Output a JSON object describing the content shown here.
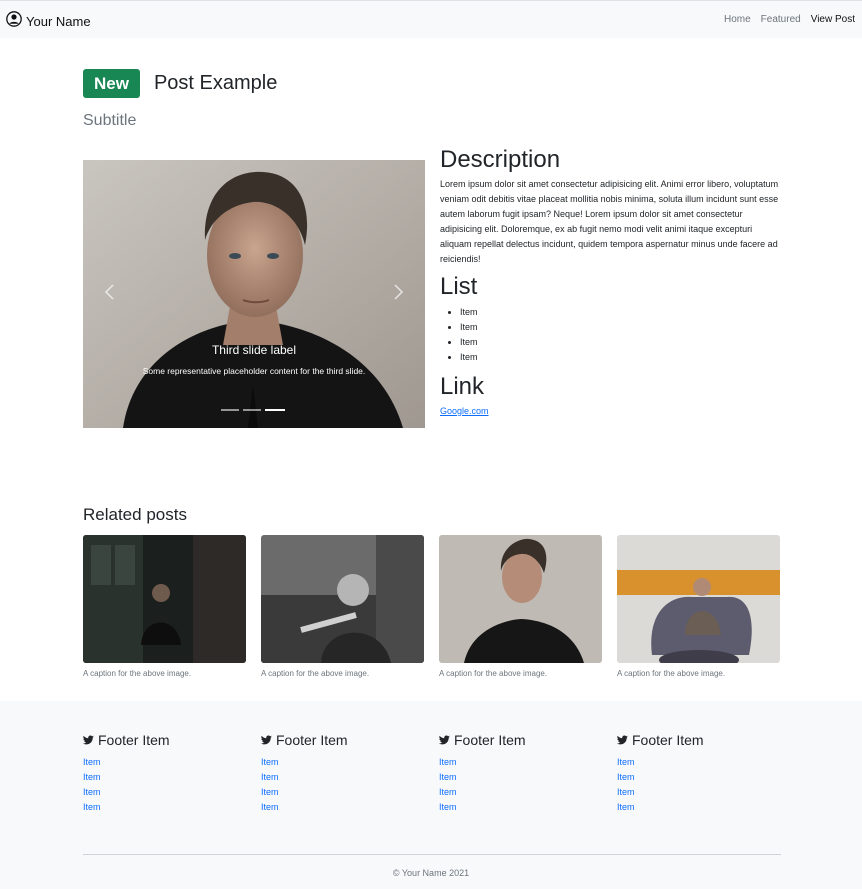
{
  "navbar": {
    "brand": "Your Name",
    "links": [
      {
        "label": "Home"
      },
      {
        "label": "Featured"
      },
      {
        "label": "View Post"
      }
    ]
  },
  "post": {
    "badge": "New",
    "title": "Post Example",
    "subtitle": "Subtitle"
  },
  "carousel": {
    "caption_title": "Third slide label",
    "caption_text": "Some representative placeholder content for the third slide.",
    "slide_count": 3,
    "active_slide": 3
  },
  "description": {
    "heading": "Description",
    "body": "Lorem ipsum dolor sit amet consectetur adipisicing elit. Animi error libero, voluptatum veniam odit debitis vitae placeat mollitia nobis minima, soluta illum incidunt sunt esse autem laborum fugit ipsam? Neque! Lorem ipsum dolor sit amet consectetur adipisicing elit. Doloremque, ex ab fugit nemo modi velit animi itaque excepturi aliquam repellat delectus incidunt, quidem tempora aspernatur minus unde facere ad reiciendis!",
    "list_heading": "List",
    "list_items": [
      "Item",
      "Item",
      "Item",
      "Item"
    ],
    "link_heading": "Link",
    "link_text": "Google.com"
  },
  "related": {
    "heading": "Related posts",
    "cards": [
      {
        "caption": "A caption for the above image."
      },
      {
        "caption": "A caption for the above image."
      },
      {
        "caption": "A caption for the above image."
      },
      {
        "caption": "A caption for the above image."
      }
    ]
  },
  "footer": {
    "columns": [
      {
        "heading": "Footer Item",
        "icon": "twitter-icon",
        "items": [
          "Item",
          "Item",
          "Item",
          "Item"
        ]
      },
      {
        "heading": "Footer Item",
        "icon": "twitter-icon",
        "items": [
          "Item",
          "Item",
          "Item",
          "Item"
        ]
      },
      {
        "heading": "Footer Item",
        "icon": "twitter-icon",
        "items": [
          "Item",
          "Item",
          "Item",
          "Item"
        ]
      },
      {
        "heading": "Footer Item",
        "icon": "twitter-icon",
        "items": [
          "Item",
          "Item",
          "Item",
          "Item"
        ]
      }
    ],
    "copyright": "© Your Name 2021"
  },
  "colors": {
    "badge": "#198754",
    "link": "#0d6efd",
    "muted": "#6c757d",
    "light_bg": "#f8f9fa"
  }
}
